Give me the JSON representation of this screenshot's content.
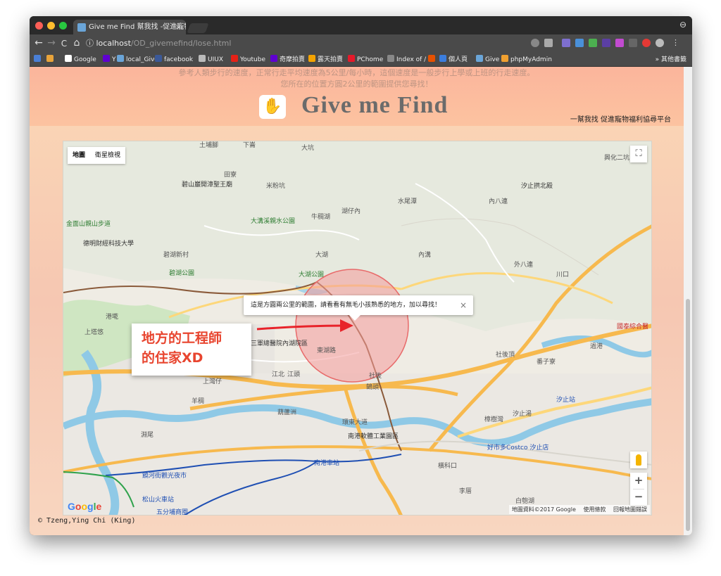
{
  "browser": {
    "tab_title": "Give me Find 幫我找 -促進寵物",
    "tab_close": "×",
    "url_host": "localhost",
    "url_path": "/OD_givemefind/lose.html",
    "nav": {
      "back": "←",
      "forward": "→",
      "reload": "C",
      "home": "⌂",
      "info": "ⓘ"
    },
    "incognito": "⊖"
  },
  "bookmarks": [
    {
      "label": "",
      "color": "#4a7fd6"
    },
    {
      "label": "",
      "color": "#e8a33a"
    },
    {
      "label": "Google",
      "color": "#ffffff"
    },
    {
      "label": "Y",
      "color": "#5f01d1"
    },
    {
      "label": "local_Give",
      "color": "#6aa5d8"
    },
    {
      "label": "facebook",
      "color": "#3b5998"
    },
    {
      "label": "UIUX",
      "color": "#bbbbbb"
    },
    {
      "label": "Youtube",
      "color": "#e62117"
    },
    {
      "label": "奇摩拍賣",
      "color": "#5f01d1"
    },
    {
      "label": "露天拍賣",
      "color": "#f4a300"
    },
    {
      "label": "PChome",
      "color": "#e6192a"
    },
    {
      "label": "Index of /",
      "color": "#888888"
    },
    {
      "label": "",
      "color": "#e65100"
    },
    {
      "label": "個人頁",
      "color": "#3b7ddd"
    },
    {
      "label": "Give",
      "color": "#6aa5d8"
    },
    {
      "label": "phpMyAdmin",
      "color": "#f0a030"
    }
  ],
  "bookmarks_more": "» 其他書籤",
  "header": {
    "ghost_line1": "參考人類步行的速度，正常行走平均速度為5公里/每小時，這個速度是一般步行上學或上班的行走速度。",
    "ghost_line2": "您所在的位置方圓2公里的範圍提供您尋找！",
    "brand": "Give me Find",
    "tagline": "一幫我找 促進寵物福利協尋平台",
    "logo_glyph": "✋"
  },
  "map": {
    "type_tabs": [
      "地圖",
      "衛星檢視"
    ],
    "fullscreen": "⛶",
    "zoom_in": "+",
    "zoom_out": "−",
    "google": "Google",
    "attribution": [
      "地圖資料©2017 Google",
      "使用條款",
      "回報地圖錯誤"
    ],
    "infowindow": "這是方圓兩公里的範圍，請看看有無毛小孩熟悉的地方，加以尋找！",
    "infowindow_close": "×",
    "annotation_line1": "地方的工程師",
    "annotation_line2": "的住家XD",
    "circle_color": "#f08080",
    "arrow_color": "#e8232a",
    "places": [
      "土埔腳",
      "下崙",
      "大坑",
      "興化二坑",
      "田寮",
      "碧山巖開漳聖王廟",
      "米粉坑",
      "汐止拱北殿",
      "水尾潭",
      "內八連",
      "湖仔內",
      "金面山親山步道",
      "德明財經科技大學",
      "大溝溪親水公園",
      "牛稠湖",
      "碧湖新村",
      "大湖",
      "內溝",
      "外八連",
      "碧湖公園",
      "大湖公園",
      "川口",
      "港墘",
      "國泰綜合醫",
      "上塔悠",
      "三軍總醫院內湖院區",
      "社後頂",
      "番子寮",
      "過港",
      "江北",
      "上灣仔",
      "江頭",
      "社後",
      "南港軟體工業園區",
      "汐止站",
      "汐止湯",
      "樟樹灣",
      "葫蘆洲",
      "好市多Costco 汐止店",
      "南港車站",
      "橫科口",
      "饒河街觀光夜市",
      "松山火車站",
      "五分埔商圈",
      "李厝",
      "白匏湖",
      "羊稠",
      "東湖路",
      "環東大道",
      "鵠頭",
      "淵尾"
    ]
  },
  "footer": "© Tzeng,Ying Chi (King)"
}
